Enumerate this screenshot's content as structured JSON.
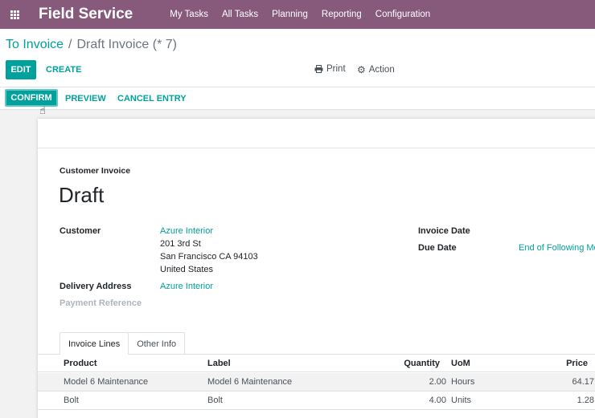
{
  "navbar": {
    "brand": "Field Service",
    "menu": [
      "My Tasks",
      "All Tasks",
      "Planning",
      "Reporting",
      "Configuration"
    ]
  },
  "breadcrumb": {
    "parent": "To Invoice",
    "separator": "/",
    "current": "Draft Invoice (* 7)"
  },
  "toolbar": {
    "edit": "EDIT",
    "create": "CREATE",
    "print": "Print",
    "action": "Action"
  },
  "statusbar": {
    "confirm": "CONFIRM",
    "preview": "PREVIEW",
    "cancel": "CANCEL ENTRY"
  },
  "form": {
    "doc_type": "Customer Invoice",
    "title": "Draft",
    "customer_label": "Customer",
    "customer_name": "Azure Interior",
    "address_line1": "201 3rd St",
    "address_line2": "San Francisco CA 94103",
    "address_line3": "United States",
    "delivery_label": "Delivery Address",
    "delivery_value": "Azure Interior",
    "payment_ref_label": "Payment Reference",
    "invoice_date_label": "Invoice Date",
    "due_date_label": "Due Date",
    "due_date_value": "End of Following Mo"
  },
  "tabs": [
    "Invoice Lines",
    "Other Info"
  ],
  "table": {
    "headers": {
      "product": "Product",
      "label": "Label",
      "quantity": "Quantity",
      "uom": "UoM",
      "price": "Price"
    },
    "rows": [
      {
        "product": "Model 6 Maintenance",
        "label": "Model 6 Maintenance",
        "quantity": "2.00",
        "uom": "Hours",
        "price": "64.17"
      },
      {
        "product": "Bolt",
        "label": "Bolt",
        "quantity": "4.00",
        "uom": "Units",
        "price": "1.28"
      }
    ]
  },
  "colors": {
    "brand": "#875a7b",
    "accent": "#00a09d"
  }
}
